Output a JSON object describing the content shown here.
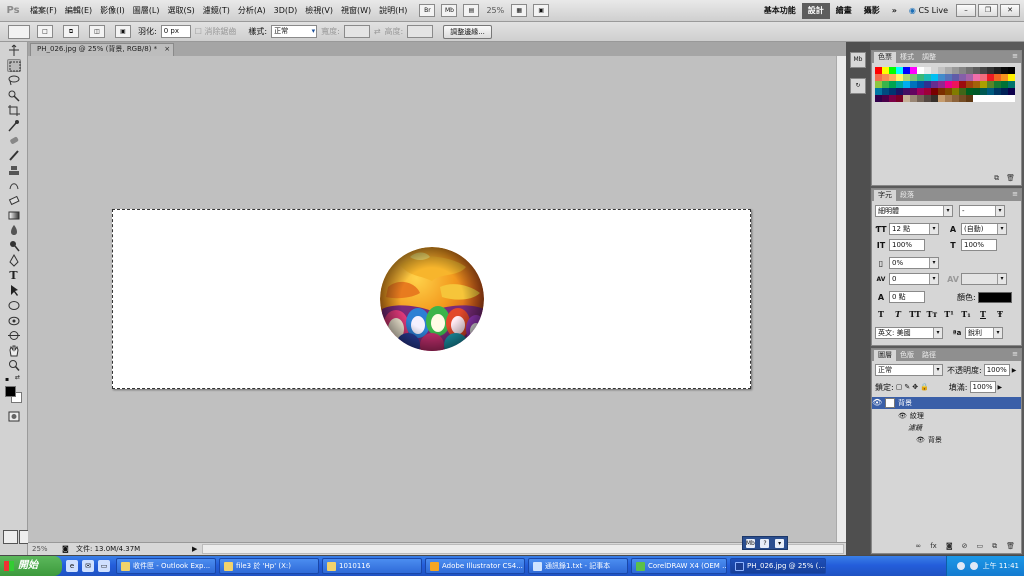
{
  "menubar": {
    "logo": "Ps",
    "menus": [
      "檔案(F)",
      "編輯(E)",
      "影像(I)",
      "圖層(L)",
      "選取(S)",
      "濾鏡(T)",
      "分析(A)",
      "3D(D)",
      "檢視(V)",
      "視窗(W)",
      "說明(H)"
    ],
    "br_label": "Br",
    "mb_label": "Mb",
    "zoom": "25%",
    "workspaces": [
      "基本功能",
      "設計",
      "繪畫",
      "攝影"
    ],
    "active_workspace": "設計",
    "more": "»",
    "cs_live": "CS Live"
  },
  "optionsbar": {
    "feather_label": "羽化:",
    "feather_value": "0 px",
    "anti_alias_label": "消除鋸齒",
    "style_label": "樣式:",
    "style_value": "正常",
    "width_label": "寬度:",
    "height_label": "高度:",
    "refine_edge": "調整邊緣..."
  },
  "document": {
    "tab_title": "PH_026.jpg @ 25% (背景, RGB/8) *",
    "close": "×",
    "status_zoom": "25%",
    "status_doc": "文件: 13.0M/4.37M"
  },
  "swatches_panel": {
    "tabs": [
      "色票",
      "樣式",
      "調整"
    ],
    "colors": [
      "#ff0000",
      "#ffff00",
      "#00ff00",
      "#00ffff",
      "#0000ff",
      "#ff00ff",
      "#ffffff",
      "#ebebeb",
      "#d6d6d6",
      "#c2c2c2",
      "#adadad",
      "#999999",
      "#858585",
      "#707070",
      "#5c5c5c",
      "#474747",
      "#333333",
      "#1f1f1f",
      "#0a0a0a",
      "#000000",
      "#f26c4f",
      "#f68e56",
      "#fbaf5d",
      "#fff568",
      "#acd372",
      "#7cc576",
      "#3bb878",
      "#1abbb4",
      "#00bff3",
      "#438ccb",
      "#5574b9",
      "#605ca8",
      "#855fa8",
      "#a763a9",
      "#f06ea9",
      "#f26d7d",
      "#ed1c24",
      "#f26522",
      "#f7941d",
      "#fff200",
      "#8dc63f",
      "#39b54a",
      "#00a651",
      "#00a99d",
      "#00aeef",
      "#0072bc",
      "#0054a6",
      "#2e3192",
      "#662d91",
      "#92278f",
      "#ec008c",
      "#ed145b",
      "#9e0b0f",
      "#a0410d",
      "#a3620a",
      "#aba000",
      "#598527",
      "#197b30",
      "#007236",
      "#00746b",
      "#0076a3",
      "#004a80",
      "#003471",
      "#1b1464",
      "#440e62",
      "#630460",
      "#9e005d",
      "#9e0039",
      "#790000",
      "#7b2e00",
      "#7d4900",
      "#827b00",
      "#406618",
      "#005e20",
      "#005826",
      "#005952",
      "#005b7f",
      "#003663",
      "#002157",
      "#0d004c",
      "#32004b",
      "#4b0049",
      "#7b0046",
      "#7a0026",
      "#c7b299",
      "#998675",
      "#736357",
      "#534741",
      "#37302a",
      "#c69c6d",
      "#a67c52",
      "#8c6239",
      "#754c24",
      "#603913",
      "#ffffff",
      "#ffffff",
      "#ffffff",
      "#ffffff",
      "#ffffff",
      "#ffffff"
    ]
  },
  "character_panel": {
    "tabs": [
      "字元",
      "段落"
    ],
    "font_family": "細明體",
    "font_style": "-",
    "size": "12 點",
    "leading": "(自動)",
    "vscale": "100%",
    "hscale": "100%",
    "tsume": "0%",
    "kerning": "0",
    "baseline": "0 點",
    "color_label": "顏色:",
    "styles": [
      "T",
      "T",
      "TT",
      "Tт",
      "T¹",
      "T₁",
      "T",
      "Ŧ"
    ],
    "language": "英文: 美國",
    "aa_label": "ªa",
    "aa_value": "銳利",
    "text_color": "#000000"
  },
  "layers_panel": {
    "tabs": [
      "圖層",
      "色版",
      "路徑"
    ],
    "blend_mode": "正常",
    "opacity_label": "不透明度:",
    "opacity": "100%",
    "lock_label": "鎖定:",
    "fill_label": "填滿:",
    "fill": "100%",
    "layers": [
      {
        "name": "背景",
        "selected": true,
        "indent": 0
      },
      {
        "name": "紋理",
        "selected": false,
        "indent": 1
      },
      {
        "name": "濾鏡",
        "selected": false,
        "indent": 2
      },
      {
        "name": "背景",
        "selected": false,
        "indent": 3
      }
    ],
    "footer_icons": [
      "∞",
      "fx",
      "◙",
      "⊘",
      "▭",
      "⧉",
      "🗑"
    ]
  },
  "taskbar": {
    "start": "開始",
    "tasks": [
      {
        "label": "收件匣 - Outlook Exp...",
        "active": false
      },
      {
        "label": "file3 於 'Hp' (X:)",
        "active": false
      },
      {
        "label": "1010116",
        "active": false
      },
      {
        "label": "Adobe Illustrator CS4...",
        "active": false
      },
      {
        "label": "通訊錄1.txt - 記事本",
        "active": false
      },
      {
        "label": "CorelDRAW X4 (OEM ...",
        "active": false
      },
      {
        "label": "PH_026.jpg @ 25% (...",
        "active": true
      }
    ],
    "clock": "上午 11:41"
  }
}
